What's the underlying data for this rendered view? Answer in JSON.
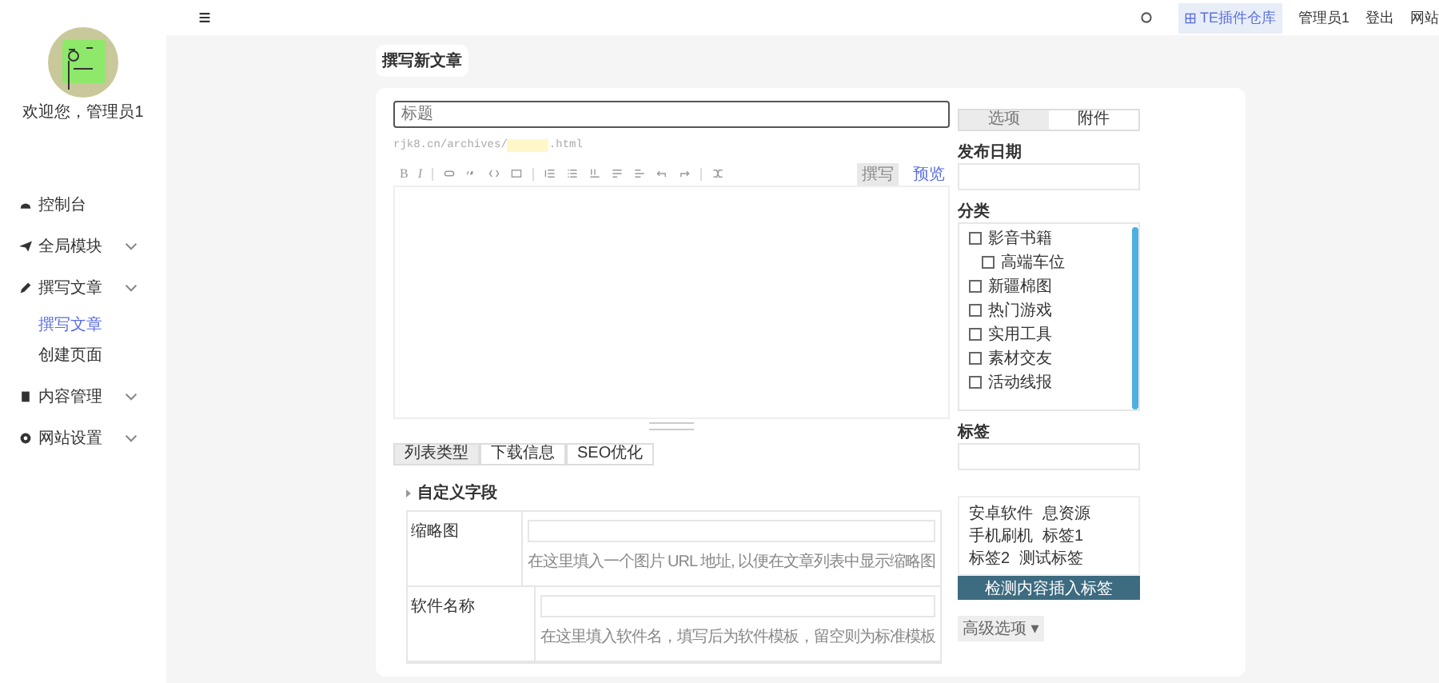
{
  "sidebar": {
    "welcome": "欢迎您，管理员1",
    "items": [
      {
        "label": "控制台",
        "kind": "link"
      },
      {
        "label": "全局模块",
        "kind": "group"
      },
      {
        "label": "撰写文章",
        "kind": "group",
        "children": [
          {
            "label": "撰写文章",
            "selected": true
          },
          {
            "label": "创建页面",
            "selected": false
          }
        ]
      },
      {
        "label": "内容管理",
        "kind": "group"
      },
      {
        "label": "网站设置",
        "kind": "group"
      }
    ]
  },
  "topbar": {
    "plugin_link": "TE插件仓库",
    "user": "管理员1",
    "logout": "登出",
    "site": "网站"
  },
  "page_title": "撰写新文章",
  "editor": {
    "title_placeholder": "标题",
    "url_prefix": "rjk8.cn/archives/",
    "url_suffix": ".html",
    "toolbar_glyphs": [
      "B",
      "I"
    ],
    "modes": [
      {
        "label": "撰写",
        "selected": true
      },
      {
        "label": "预览",
        "selected": false
      }
    ]
  },
  "bottom_tabs": [
    {
      "label": "列表类型",
      "selected": true
    },
    {
      "label": "下载信息",
      "selected": false
    },
    {
      "label": "SEO优化",
      "selected": false
    }
  ],
  "custom_fields": {
    "title": "自定义字段",
    "fields": [
      {
        "label": "缩略图",
        "hint": "在这里填入一个图片 URL 地址, 以便在文章列表中显示缩略图"
      },
      {
        "label": "软件名称",
        "hint": "在这里填入软件名，填写后为软件模板，留空则为标准模板"
      }
    ]
  },
  "side": {
    "tabs": [
      {
        "label": "选项",
        "selected": true
      },
      {
        "label": "附件",
        "selected": false
      }
    ],
    "date_label": "发布日期",
    "category_label": "分类",
    "categories": [
      {
        "label": "影音书籍",
        "checked": false,
        "children": [
          {
            "label": "高端车位",
            "checked": false
          }
        ]
      },
      {
        "label": "新疆棉图",
        "checked": false
      },
      {
        "label": "热门游戏",
        "checked": false
      },
      {
        "label": "实用工具",
        "checked": false
      },
      {
        "label": "素材交友",
        "checked": false
      },
      {
        "label": "活动线报",
        "checked": false
      }
    ],
    "tags_label": "标签",
    "tag_cloud": [
      "安卓软件",
      "息资源",
      "手机刷机",
      "标签1",
      "标签2",
      "测试标签"
    ],
    "detect_button": "检测内容插入标签",
    "advanced": "高级选项",
    "advanced_caret": "▾"
  }
}
